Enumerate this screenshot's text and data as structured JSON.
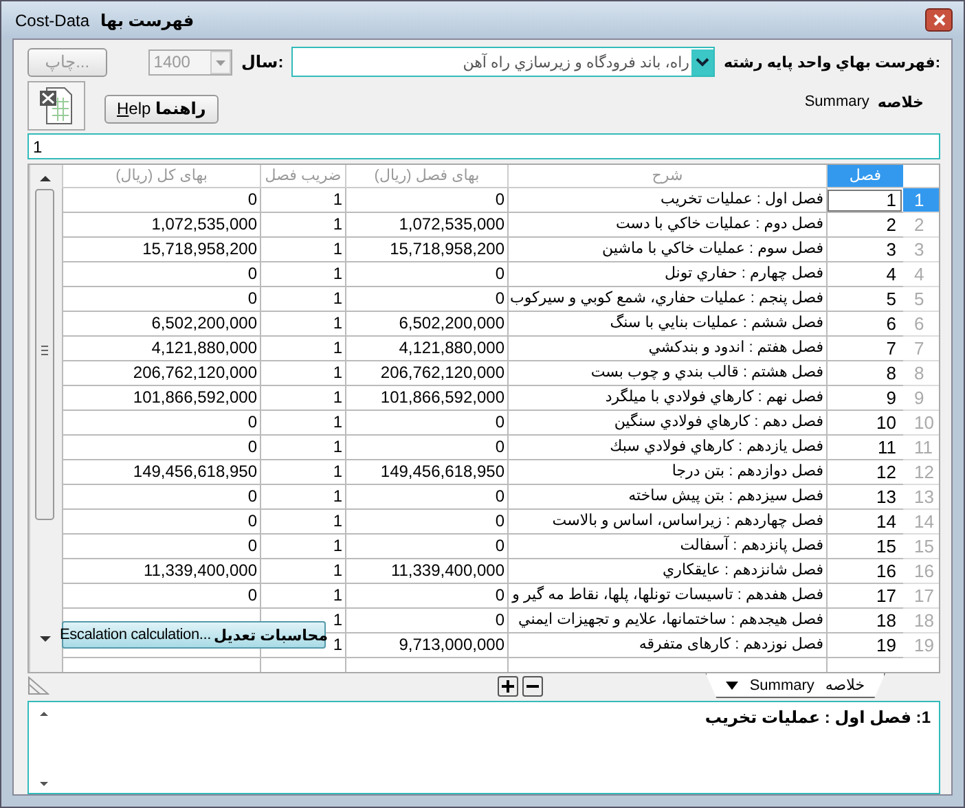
{
  "window": {
    "title": "Cost-Data",
    "subtitle": "فهرست بها"
  },
  "toolbar": {
    "print_button": {
      "label": "چاپ...",
      "disabled": true
    },
    "year": {
      "label": "سال:",
      "value": "1400",
      "disabled": true
    },
    "price_list": {
      "label": "فهرست بهاي واحد پايه رشته:",
      "value": "راه، باند فرودگاه و زيرسازي راه آهن"
    },
    "help_button": {
      "label": "Help",
      "label_fa": "راهنما"
    },
    "summary_label": {
      "en": "Summary",
      "fa": "خلاصه"
    }
  },
  "filter": {
    "value": "1"
  },
  "table": {
    "columns": [
      {
        "label": "فصل",
        "selected": true
      },
      {
        "label": "شرح",
        "selected": false
      },
      {
        "label": "بهای فصل (ریال)",
        "selected": false
      },
      {
        "label": "ضريب فصل",
        "selected": false
      },
      {
        "label": "بهای کل (ریال)",
        "selected": false
      }
    ],
    "rows": [
      {
        "num": "1",
        "cells": [
          "1",
          "فصل اول : عمليات تخريب",
          "0",
          "1",
          "0"
        ],
        "selected": true
      },
      {
        "num": "2",
        "cells": [
          "2",
          "فصل دوم : عمليات خاكي با دست",
          "1,072,535,000",
          "1",
          "1,072,535,000"
        ],
        "selected": false
      },
      {
        "num": "3",
        "cells": [
          "3",
          "فصل سوم : عمليات خاكي با ماشين",
          "15,718,958,200",
          "1",
          "15,718,958,200"
        ],
        "selected": false
      },
      {
        "num": "4",
        "cells": [
          "4",
          "فصل چهارم : حفاري تونل",
          "0",
          "1",
          "0"
        ],
        "selected": false
      },
      {
        "num": "5",
        "cells": [
          "5",
          "فصل پنجم : عمليات حفاري، شمع كوبي و سيركوب",
          "0",
          "1",
          "0"
        ],
        "selected": false
      },
      {
        "num": "6",
        "cells": [
          "6",
          "فصل ششم : عمليات بنايي با سنگ",
          "6,502,200,000",
          "1",
          "6,502,200,000"
        ],
        "selected": false
      },
      {
        "num": "7",
        "cells": [
          "7",
          "فصل هفتم : اندود و بندكشي",
          "4,121,880,000",
          "1",
          "4,121,880,000"
        ],
        "selected": false
      },
      {
        "num": "8",
        "cells": [
          "8",
          "فصل هشتم : قالب بندي و چوب بست",
          "206,762,120,000",
          "1",
          "206,762,120,000"
        ],
        "selected": false
      },
      {
        "num": "9",
        "cells": [
          "9",
          "فصل نهم : كارهاي فولادي با ميلگرد",
          "101,866,592,000",
          "1",
          "101,866,592,000"
        ],
        "selected": false
      },
      {
        "num": "10",
        "cells": [
          "10",
          "فصل دهم : كارهاي فولادي سنگين",
          "0",
          "1",
          "0"
        ],
        "selected": false
      },
      {
        "num": "11",
        "cells": [
          "11",
          "فصل يازدهم : كارهاي فولادي سبك",
          "0",
          "1",
          "0"
        ],
        "selected": false
      },
      {
        "num": "12",
        "cells": [
          "12",
          "فصل دوازدهم : بتن درجا",
          "149,456,618,950",
          "1",
          "149,456,618,950"
        ],
        "selected": false
      },
      {
        "num": "13",
        "cells": [
          "13",
          "فصل سيزدهم : بتن پيش ساخته",
          "0",
          "1",
          "0"
        ],
        "selected": false
      },
      {
        "num": "14",
        "cells": [
          "14",
          "فصل چهاردهم : زيراساس، اساس و بالاست",
          "0",
          "1",
          "0"
        ],
        "selected": false
      },
      {
        "num": "15",
        "cells": [
          "15",
          "فصل پانزدهم : آسفالت",
          "0",
          "1",
          "0"
        ],
        "selected": false
      },
      {
        "num": "16",
        "cells": [
          "16",
          "فصل شانزدهم : عايقكاري",
          "11,339,400,000",
          "1",
          "11,339,400,000"
        ],
        "selected": false
      },
      {
        "num": "17",
        "cells": [
          "17",
          "فصل هفدهم : تاسيسات تونلها، پلها، نقاط مه گير و",
          "0",
          "1",
          "0"
        ],
        "selected": false
      },
      {
        "num": "18",
        "cells": [
          "18",
          "فصل هيجدهم : ساختمانها، علايم و تجهيزات ايمني",
          "0",
          "1"
        ],
        "selected": false
      },
      {
        "num": "19",
        "cells": [
          "19",
          "فصل نوزدهم : كارهای متفرقه",
          "9,713,000,000",
          "1"
        ],
        "selected": false
      }
    ]
  },
  "popup": {
    "label": "Escalation calculation...",
    "label_fa": "محاسبات تعديل"
  },
  "bottom_tab": {
    "en": "Summary",
    "fa": "خلاصه"
  },
  "memo": {
    "text": "1: فصل اول : عمليات تخريب"
  }
}
